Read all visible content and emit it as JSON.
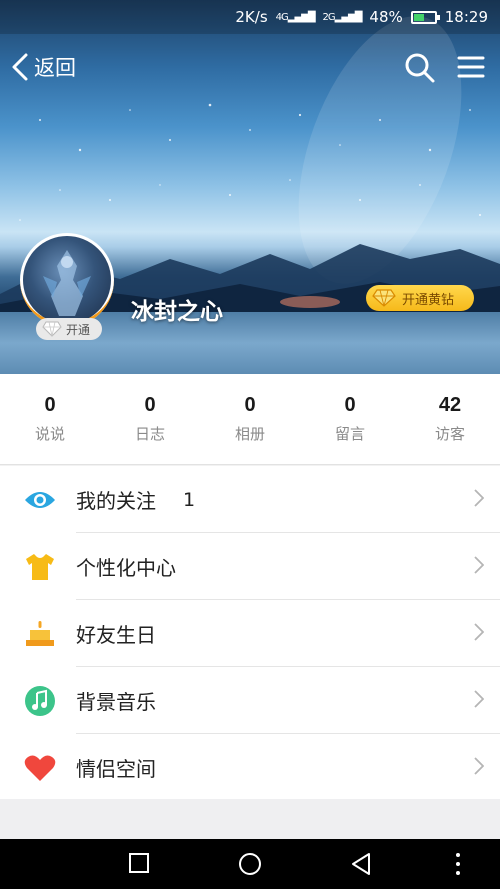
{
  "status": {
    "speed": "2K/s",
    "net1": "4G",
    "net2": "2G",
    "battery": "48%",
    "battery_level": 0.48,
    "time": "18:29"
  },
  "nav": {
    "back_label": "返回"
  },
  "profile": {
    "username": "冰封之心",
    "vip_label": "开通",
    "yellow_diamond_label": "开通黄钻"
  },
  "stats": [
    {
      "value": "0",
      "label": "说说"
    },
    {
      "value": "0",
      "label": "日志"
    },
    {
      "value": "0",
      "label": "相册"
    },
    {
      "value": "0",
      "label": "留言"
    },
    {
      "value": "42",
      "label": "访客"
    }
  ],
  "menu": [
    {
      "label": "我的关注",
      "count": "1",
      "icon": "eye-icon",
      "color": "#2aa6e0"
    },
    {
      "label": "个性化中心",
      "count": "",
      "icon": "tshirt-icon",
      "color": "#f7bb16"
    },
    {
      "label": "好友生日",
      "count": "",
      "icon": "cake-icon",
      "color": "#f5a623"
    },
    {
      "label": "背景音乐",
      "count": "",
      "icon": "music-icon",
      "color": "#3cc48a"
    },
    {
      "label": "情侣空间",
      "count": "",
      "icon": "heart-icon",
      "color": "#f0473d"
    }
  ],
  "colors": {
    "accent_gold": "#f6b91a",
    "text_primary": "#222222",
    "text_secondary": "#8a8a8a"
  }
}
